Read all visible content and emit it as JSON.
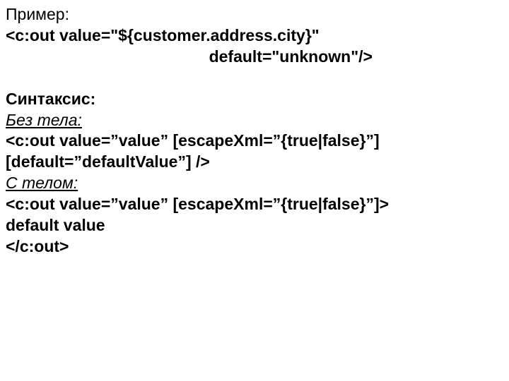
{
  "example": {
    "label": "Пример:",
    "code1": "<c:out value=\"${customer.address.city}\"",
    "code2_prefix": "                                             ",
    "code2": "default=\"unknown\"/>"
  },
  "syntax": {
    "label": "Синтаксис:",
    "nobody_label": "Без тела:",
    "nobody_code1": "<c:out value=”value” [escapeXml=”{true|false}”]",
    "nobody_code2": " [default=”defaultValue”] />",
    "withbody_label": "С телом:",
    "withbody_code1": "<c:out value=”value” [escapeXml=”{true|false}”]>",
    "withbody_code2": " default value",
    "withbody_code3": "</c:out>"
  }
}
